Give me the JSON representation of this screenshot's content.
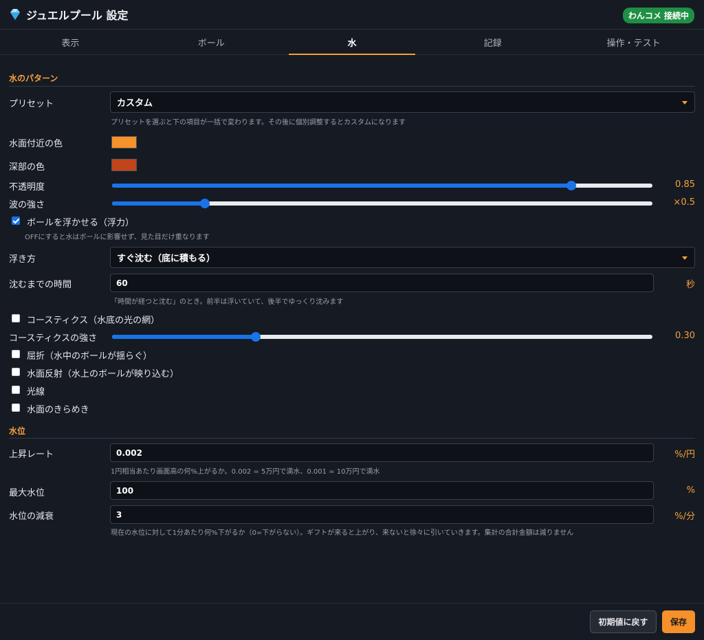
{
  "header": {
    "title": "ジュエルプール 設定",
    "gem_icon": "gem-icon",
    "badge": "わんコメ 接続中"
  },
  "tabs": [
    {
      "label": "表示",
      "active": false
    },
    {
      "label": "ボール",
      "active": false
    },
    {
      "label": "水",
      "active": true
    },
    {
      "label": "記録",
      "active": false
    },
    {
      "label": "操作・テスト",
      "active": false
    }
  ],
  "water_pattern": {
    "section_title": "水のパターン",
    "preset": {
      "label": "プリセット",
      "value": "カスタム",
      "hint": "プリセットを選ぶと下の項目が一括で変わります。その後に個別調整するとカスタムになります"
    },
    "surface_color": {
      "label": "水面付近の色",
      "color": "#f5922a"
    },
    "deep_color": {
      "label": "深部の色",
      "color": "#c2441a"
    },
    "opacity": {
      "label": "不透明度",
      "value": 0.85,
      "display": "0.85"
    },
    "wave_strength": {
      "label": "波の強さ",
      "fraction": 0.172,
      "display": "×0.5"
    },
    "buoyancy": {
      "label": "ボールを浮かせる（浮力）",
      "checked": true,
      "hint": "OFFにすると水はボールに影響せず、見た目だけ重なります"
    },
    "float_mode": {
      "label": "浮き方",
      "value": "すぐ沈む（底に積もる）"
    },
    "sink_time": {
      "label": "沈むまでの時間",
      "value": "60",
      "unit": "秒",
      "hint": "「時間が経つと沈む」のとき。前半は浮いていて、後半でゆっくり沈みます"
    },
    "caustics": {
      "label": "コースティクス（水底の光の網）",
      "checked": false
    },
    "caustics_strength": {
      "label": "コースティクスの強さ",
      "fraction": 0.266,
      "display": "0.30"
    },
    "refraction": {
      "label": "屈折（水中のボールが揺らぐ）",
      "checked": false
    },
    "reflection": {
      "label": "水面反射（水上のボールが映り込む）",
      "checked": false
    },
    "light_rays": {
      "label": "光線",
      "checked": false
    },
    "sparkle": {
      "label": "水面のきらめき",
      "checked": false
    }
  },
  "water_level": {
    "section_title": "水位",
    "rise_rate": {
      "label": "上昇レート",
      "value": "0.002",
      "unit": "%/円",
      "hint": "1円相当あたり画面高の何%上がるか。0.002 = 5万円で満水、0.001 = 10万円で満水"
    },
    "max_level": {
      "label": "最大水位",
      "value": "100",
      "unit": "%"
    },
    "decay": {
      "label": "水位の減衰",
      "value": "3",
      "unit": "%/分",
      "hint": "現在の水位に対して1分あたり何%下がるか（0=下がらない）。ギフトが来ると上がり、来ないと徐々に引いていきます。集計の合計金額は減りません"
    }
  },
  "footer": {
    "reset_label": "初期値に戻す",
    "save_label": "保存"
  }
}
